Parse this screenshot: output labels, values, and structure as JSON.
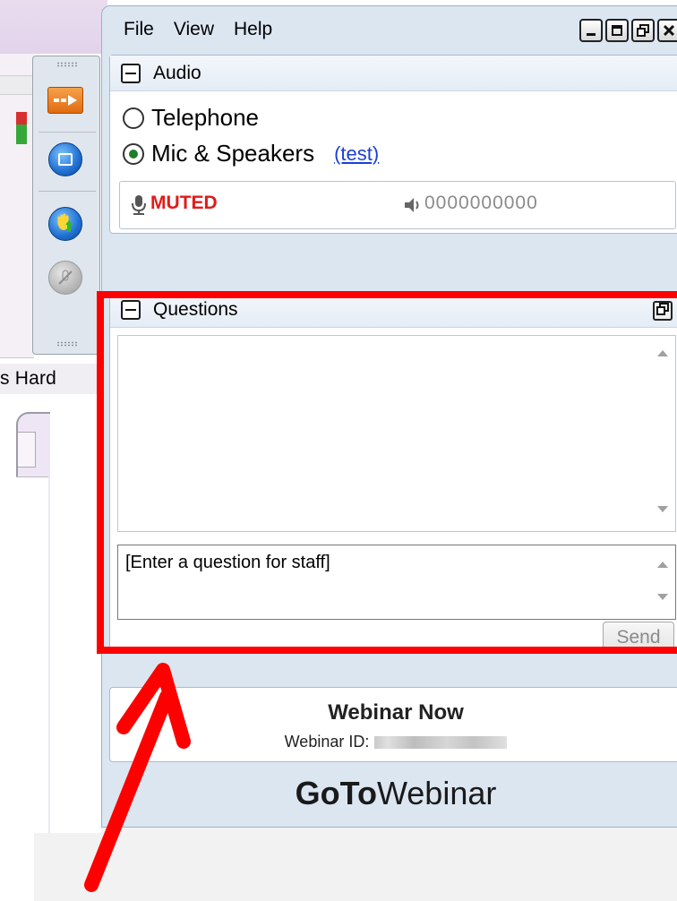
{
  "background": {
    "partial_text": "s Hard"
  },
  "menu": {
    "file": "File",
    "view": "View",
    "help": "Help"
  },
  "window_buttons": {
    "minimize": "_",
    "maximize": "□",
    "restore": "⧉",
    "close": "×"
  },
  "audio": {
    "title": "Audio",
    "telephone_label": "Telephone",
    "mic_label": "Mic & Speakers",
    "test_link": "(test)",
    "selected": "Mic & Speakers",
    "muted_label": "MUTED",
    "level_meter": "0000000000"
  },
  "questions": {
    "title": "Questions",
    "input_placeholder": "[Enter a question for staff]",
    "send_label": "Send"
  },
  "webinar": {
    "title": "Webinar Now",
    "id_label": "Webinar ID:"
  },
  "brand": {
    "logo_bold": "GoTo",
    "logo_regular": "Webinar"
  },
  "annotation": {
    "highlight_color": "#ff0000"
  },
  "colors": {
    "panel_bg": "#dbe6f1",
    "muted_red": "#e21a1a",
    "link_blue": "#1c3fd6"
  }
}
